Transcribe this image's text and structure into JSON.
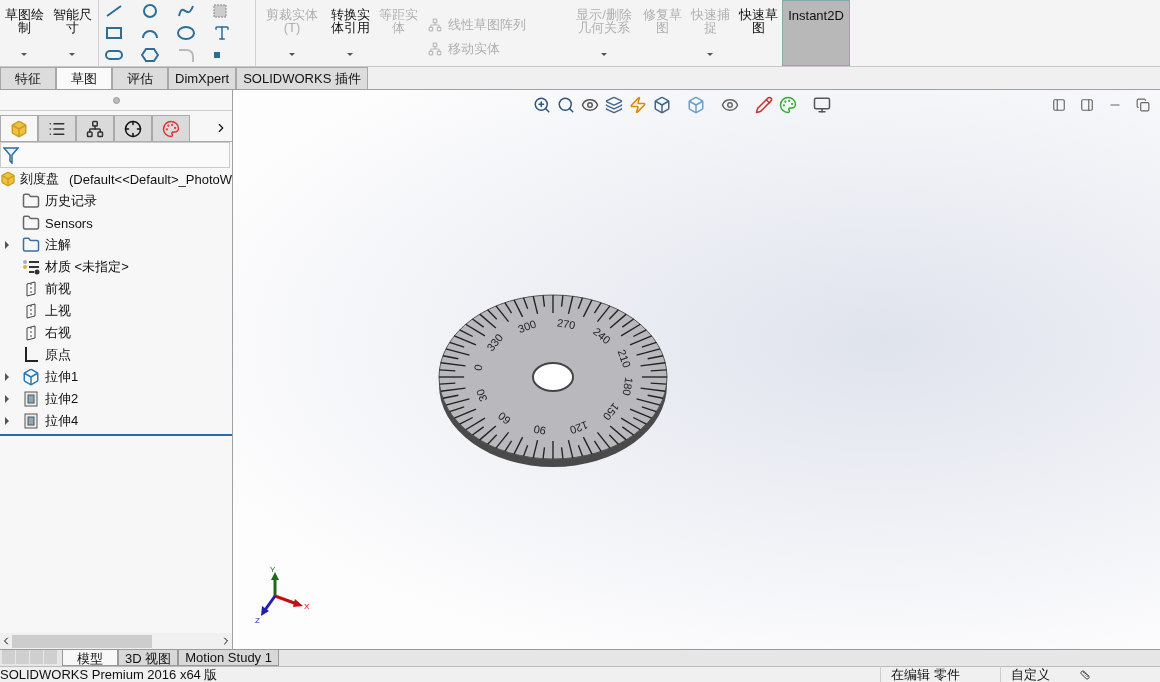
{
  "ribbon": [
    {
      "kind": "big",
      "label": "草图绘制",
      "disabled": false,
      "selected": false,
      "dropdown": true
    },
    {
      "kind": "big",
      "label": "智能尺寸",
      "disabled": false,
      "selected": false,
      "dropdown": true
    },
    {
      "kind": "tools"
    },
    {
      "kind": "big",
      "label": "剪裁实体(T)",
      "disabled": true,
      "selected": false,
      "dropdown": true
    },
    {
      "kind": "big",
      "label": "转换实体引用",
      "disabled": false,
      "selected": false,
      "dropdown": true
    },
    {
      "kind": "big",
      "label": "等距实体",
      "disabled": true,
      "selected": false,
      "dropdown": false
    },
    {
      "kind": "list",
      "items": [
        {
          "label": "线性草图阵列",
          "disabled": true
        },
        {
          "label": "移动实体",
          "disabled": true
        }
      ]
    },
    {
      "kind": "big",
      "label": "显示/删除几何关系",
      "disabled": true,
      "selected": false,
      "dropdown": true
    },
    {
      "kind": "big",
      "label": "修复草图",
      "disabled": true,
      "selected": false,
      "dropdown": false
    },
    {
      "kind": "big",
      "label": "快速捕捉",
      "disabled": true,
      "selected": false,
      "dropdown": true
    },
    {
      "kind": "big",
      "label": "快速草图",
      "disabled": false,
      "selected": false,
      "dropdown": false
    },
    {
      "kind": "big",
      "label": "Instant2D",
      "disabled": false,
      "selected": true,
      "dropdown": false
    }
  ],
  "command_tabs": [
    {
      "label": "特征",
      "selected": false
    },
    {
      "label": "草图",
      "selected": true
    },
    {
      "label": "评估",
      "selected": false
    },
    {
      "label": "DimXpert",
      "selected": false
    },
    {
      "label": "SOLIDWORKS 插件",
      "selected": false
    }
  ],
  "panel_tabs": [
    {
      "selected": true
    },
    {
      "selected": false
    },
    {
      "selected": false
    },
    {
      "selected": false
    },
    {
      "selected": false
    }
  ],
  "tree": {
    "root": {
      "label": "刻度盘",
      "config": "(Default<<Default>_PhotoW"
    },
    "items": [
      {
        "kind": "history",
        "label": "历史记录"
      },
      {
        "kind": "sensors",
        "label": "Sensors"
      },
      {
        "kind": "annotations",
        "label": "注解",
        "expanded": false
      },
      {
        "kind": "material",
        "label": "材质 <未指定>"
      },
      {
        "kind": "plane",
        "label": "前视"
      },
      {
        "kind": "plane",
        "label": "上视"
      },
      {
        "kind": "plane",
        "label": "右视"
      },
      {
        "kind": "origin",
        "label": "原点"
      },
      {
        "kind": "extrude",
        "label": "拉伸1",
        "expanded": false
      },
      {
        "kind": "cut",
        "label": "拉伸2",
        "expanded": false
      },
      {
        "kind": "cut",
        "label": "拉伸4",
        "expanded": false
      }
    ]
  },
  "dial_labels": [
    "0",
    "30",
    "60",
    "90",
    "120",
    "150",
    "180",
    "210",
    "240",
    "270",
    "300",
    "330"
  ],
  "triad": {
    "x": "X",
    "y": "Y",
    "z": "Z"
  },
  "bottom_tabs": [
    {
      "label": "模型",
      "selected": true
    },
    {
      "label": "3D 视图",
      "selected": false
    },
    {
      "label": "Motion Study 1",
      "selected": false
    }
  ],
  "status_bar": {
    "product": "SOLIDWORKS Premium 2016 x64 版",
    "mode": "在编辑 零件",
    "units": "自定义"
  }
}
